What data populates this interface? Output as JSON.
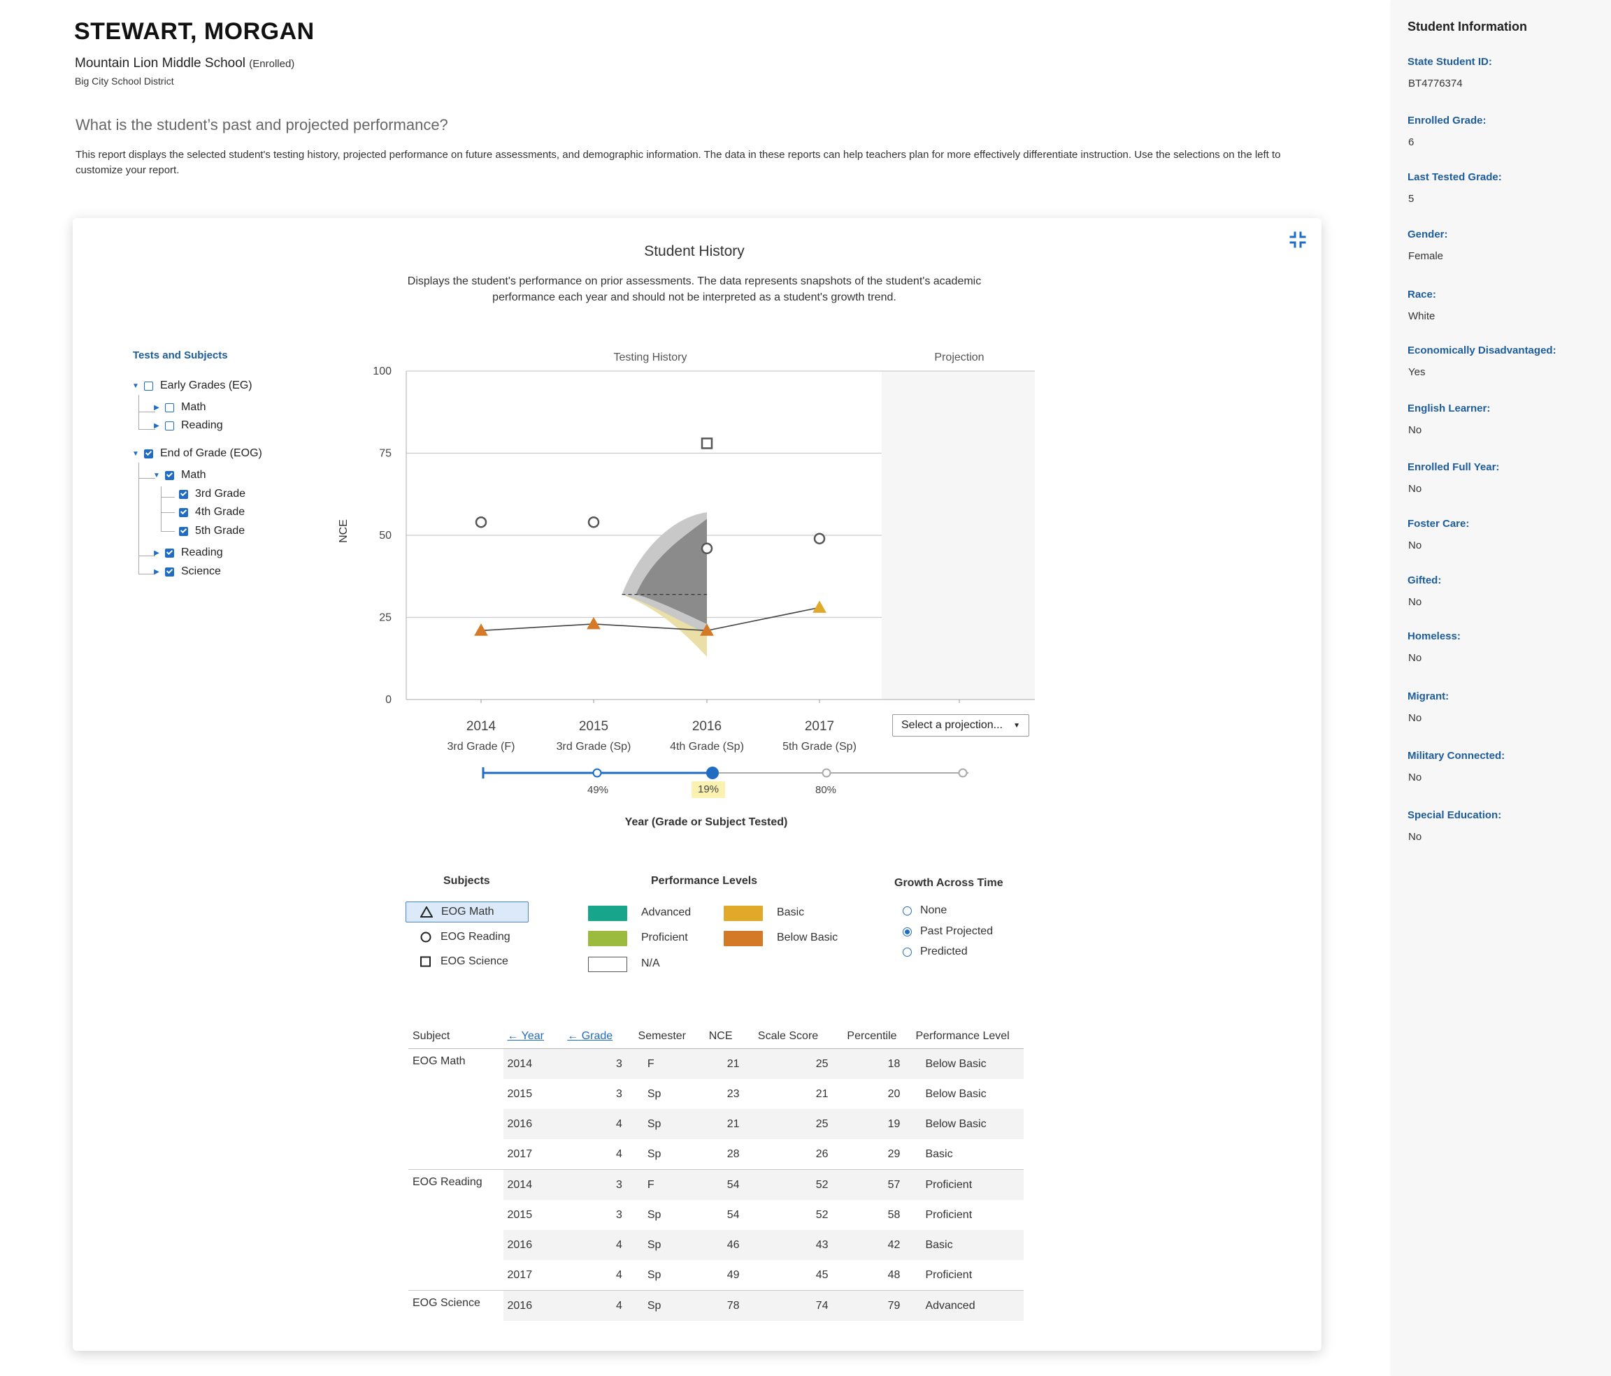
{
  "header": {
    "student_name": "STEWART, MORGAN",
    "school": "Mountain Lion Middle School",
    "enrollment": "(Enrolled)",
    "district": "Big City School District",
    "question": "What is the student’s past and projected performance?",
    "description": "This report displays the selected student's testing history,  projected performance on future assessments, and demographic information. The data in these reports can help teachers plan for more effectively differentiate  instruction. Use the selections on the left to customize your report."
  },
  "card": {
    "title": "Student History",
    "description": "Displays the student's performance on prior assessments. The data represents snapshots of the student's academic performance each year and should not be interpreted as a student's growth trend.",
    "collapse_icon": "collapse-icon"
  },
  "tree": {
    "title": "Tests and Subjects",
    "items": [
      {
        "label": "Early Grades (EG)",
        "checked": false,
        "expanded": true
      },
      {
        "label": "Math",
        "checked": false,
        "expanded": false
      },
      {
        "label": "Reading",
        "checked": false,
        "expanded": false
      },
      {
        "label": "End of Grade (EOG)",
        "checked": true,
        "expanded": true
      },
      {
        "label": "Math",
        "checked": true,
        "expanded": true
      },
      {
        "label": "3rd Grade",
        "checked": true
      },
      {
        "label": "4th Grade",
        "checked": true
      },
      {
        "label": "5th Grade",
        "checked": true
      },
      {
        "label": "Reading",
        "checked": true,
        "expanded": false
      },
      {
        "label": "Science",
        "checked": true,
        "expanded": false
      }
    ]
  },
  "chart_data": {
    "type": "scatter",
    "section_labels": [
      "Testing History",
      "Projection"
    ],
    "ylabel": "NCE",
    "ylim": [
      0,
      100
    ],
    "yticks": [
      0,
      25,
      50,
      75,
      100
    ],
    "categories": [
      {
        "year": "2014",
        "grade": "3rd Grade (F)"
      },
      {
        "year": "2015",
        "grade": "3rd Grade (Sp)"
      },
      {
        "year": "2016",
        "grade": "4th Grade (Sp)"
      },
      {
        "year": "2017",
        "grade": "5th Grade (Sp)"
      }
    ],
    "series": [
      {
        "name": "EOG Math",
        "marker": "triangle",
        "values": [
          21,
          23,
          21,
          28
        ],
        "levels": [
          "Below Basic",
          "Below Basic",
          "Below Basic",
          "Basic"
        ],
        "line": true
      },
      {
        "name": "EOG Reading",
        "marker": "circle",
        "values": [
          54,
          54,
          46,
          49
        ],
        "line": false
      },
      {
        "name": "EOG Science",
        "marker": "square",
        "x_index": [
          2
        ],
        "values": [
          78
        ],
        "line": false
      }
    ],
    "projection_band": {
      "x_start": 1.25,
      "x_end": 2,
      "center": 32
    },
    "xlabel": "Year (Grade or Subject Tested)",
    "slider": {
      "labels": [
        "49%",
        "19%",
        "80%"
      ],
      "selected": "19%"
    }
  },
  "projection_select": {
    "label": "Select a projection..."
  },
  "legend": {
    "subjects_title": "Subjects",
    "subjects": [
      {
        "label": "EOG Math",
        "icon": "triangle-icon",
        "selected": true
      },
      {
        "label": "EOG Reading",
        "icon": "circle-icon",
        "selected": false
      },
      {
        "label": "EOG Science",
        "icon": "square-icon",
        "selected": false
      }
    ],
    "levels_title": "Performance Levels",
    "levels": [
      {
        "label": "Advanced",
        "color": "#17a58b"
      },
      {
        "label": "Basic",
        "color": "#e0a92a"
      },
      {
        "label": "Proficient",
        "color": "#9bbb3f"
      },
      {
        "label": "Below Basic",
        "color": "#d47a26"
      },
      {
        "label": "N/A",
        "color": "#ffffff"
      }
    ],
    "growth_title": "Growth Across Time",
    "growth_options": [
      {
        "label": "None",
        "selected": false
      },
      {
        "label": "Past Projected",
        "selected": true
      },
      {
        "label": "Predicted",
        "selected": false
      }
    ]
  },
  "table": {
    "headers": [
      "Subject",
      "Year",
      "Grade",
      "Semester",
      "NCE",
      "Scale Score",
      "Percentile",
      "Performance Level"
    ],
    "sort_arrow": "←",
    "groups": [
      {
        "subject": "EOG Math",
        "rows": [
          [
            "2014",
            "3",
            "F",
            "21",
            "25",
            "18",
            "Below Basic"
          ],
          [
            "2015",
            "3",
            "Sp",
            "23",
            "21",
            "20",
            "Below Basic"
          ],
          [
            "2016",
            "4",
            "Sp",
            "21",
            "25",
            "19",
            "Below Basic"
          ],
          [
            "2017",
            "4",
            "Sp",
            "28",
            "26",
            "29",
            "Basic"
          ]
        ]
      },
      {
        "subject": "EOG Reading",
        "rows": [
          [
            "2014",
            "3",
            "F",
            "54",
            "52",
            "57",
            "Proficient"
          ],
          [
            "2015",
            "3",
            "Sp",
            "54",
            "52",
            "58",
            "Proficient"
          ],
          [
            "2016",
            "4",
            "Sp",
            "46",
            "43",
            "42",
            "Basic"
          ],
          [
            "2017",
            "4",
            "Sp",
            "49",
            "45",
            "48",
            "Proficient"
          ]
        ]
      },
      {
        "subject": "EOG Science",
        "rows": [
          [
            "2016",
            "4",
            "Sp",
            "78",
            "74",
            "79",
            "Advanced"
          ]
        ]
      }
    ]
  },
  "info": {
    "title": "Student Information",
    "fields": [
      {
        "label": "State Student ID:",
        "value": "BT4776374"
      },
      {
        "label": "Enrolled Grade:",
        "value": "6"
      },
      {
        "label": "Last Tested Grade:",
        "value": "5"
      },
      {
        "label": "Gender:",
        "value": "Female"
      },
      {
        "label": "Race:",
        "value": "White"
      },
      {
        "label": "Economically Disadvantaged:",
        "value": "Yes"
      },
      {
        "label": "English Learner:",
        "value": "No"
      },
      {
        "label": "Enrolled Full Year:",
        "value": "No"
      },
      {
        "label": "Foster Care:",
        "value": "No"
      },
      {
        "label": "Gifted:",
        "value": "No"
      },
      {
        "label": "Homeless:",
        "value": "No"
      },
      {
        "label": "Migrant:",
        "value": "No"
      },
      {
        "label": "Military Connected:",
        "value": "No"
      },
      {
        "label": "Special Education:",
        "value": "No"
      }
    ]
  }
}
